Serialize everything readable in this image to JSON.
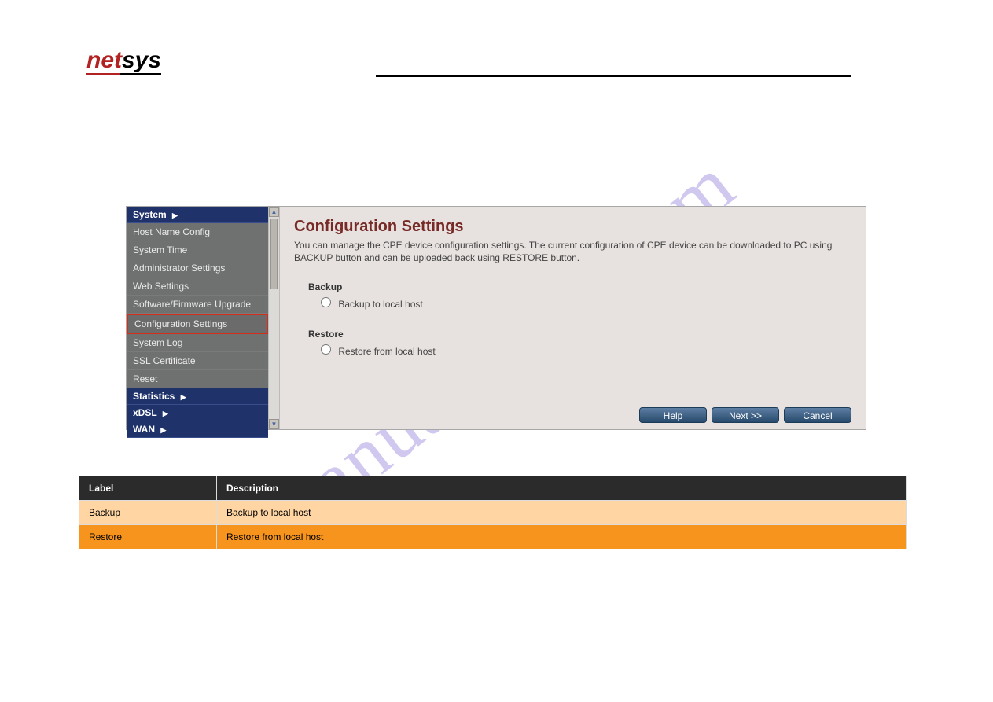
{
  "logo": {
    "brand_part1": "net",
    "brand_part2": "sys"
  },
  "cpe": {
    "sidebar": {
      "categories": {
        "system": "System",
        "statistics": "Statistics",
        "xdsl": "xDSL",
        "wan": "WAN"
      },
      "items": [
        "Host Name Config",
        "System Time",
        "Administrator Settings",
        "Web Settings",
        "Software/Firmware Upgrade",
        "Configuration Settings",
        "System Log",
        "SSL Certificate",
        "Reset"
      ],
      "selected_index": 5
    },
    "main": {
      "title": "Configuration Settings",
      "description": "You can manage the CPE device configuration settings. The current configuration of CPE device can be downloaded to PC using BACKUP button and can be uploaded back using RESTORE button.",
      "backup_label": "Backup",
      "backup_option": "Backup to local host",
      "restore_label": "Restore",
      "restore_option": "Restore from local host",
      "buttons": {
        "help": "Help",
        "next": "Next >>",
        "cancel": "Cancel"
      }
    }
  },
  "table": {
    "head": [
      "Label",
      "Description"
    ],
    "rows": [
      [
        "Backup",
        "Backup to local host"
      ],
      [
        "Restore",
        "Restore from local host"
      ]
    ]
  },
  "watermark": "manualshive.com"
}
